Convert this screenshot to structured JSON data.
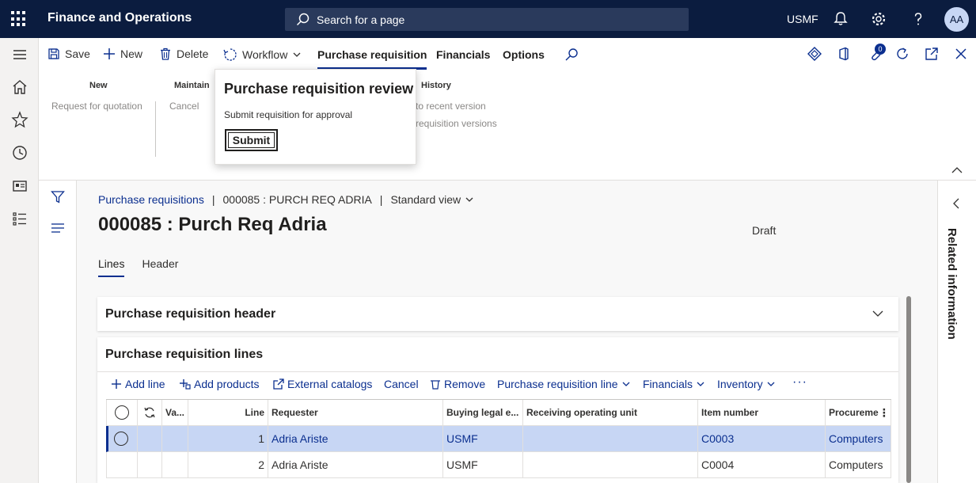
{
  "topbar": {
    "app_title": "Finance and Operations",
    "search_placeholder": "Search for a page",
    "company": "USMF",
    "avatar_initials": "AA",
    "icons": [
      "waffle-icon",
      "search-icon",
      "bell-icon",
      "gear-icon",
      "help-icon"
    ]
  },
  "actions": {
    "save": "Save",
    "new": "New",
    "delete": "Delete",
    "workflow": "Workflow",
    "tabs": [
      "Purchase requisition",
      "Financials",
      "Options"
    ],
    "notification_count": "0"
  },
  "ribbon": {
    "groups": [
      {
        "title": "New",
        "items": [
          "Request for quotation"
        ]
      },
      {
        "title": "Maintain",
        "items": [
          "Cancel"
        ]
      },
      {
        "title": "History",
        "items": [
          "to recent version",
          "requisition versions"
        ]
      }
    ]
  },
  "flyout": {
    "title": "Purchase requisition review",
    "subtitle": "Submit requisition for approval",
    "button": "Submit"
  },
  "page": {
    "breadcrumb_link": "Purchase requisitions",
    "breadcrumb_record": "000085 : PURCH REQ ADRIA",
    "view": "Standard view",
    "title": "000085 : Purch Req Adria",
    "status": "Draft",
    "tabs": [
      "Lines",
      "Header"
    ],
    "related_info": "Related information"
  },
  "header_card": {
    "title": "Purchase requisition header"
  },
  "lines_card": {
    "title": "Purchase requisition lines",
    "toolbar": [
      "Add line",
      "Add products",
      "External catalogs",
      "Cancel",
      "Remove",
      "Purchase requisition line",
      "Financials",
      "Inventory"
    ],
    "columns": [
      "Va...",
      "Line",
      "Requester",
      "Buying legal e...",
      "Receiving operating unit",
      "Item number",
      "Procureme"
    ],
    "rows": [
      {
        "line": "1",
        "requester": "Adria Ariste",
        "legal": "USMF",
        "unit": "",
        "item": "C0003",
        "proc": "Computers",
        "selected": true
      },
      {
        "line": "2",
        "requester": "Adria Ariste",
        "legal": "USMF",
        "unit": "",
        "item": "C0004",
        "proc": "Computers",
        "selected": false
      }
    ]
  },
  "colors": {
    "topbar": "#0b1c3f",
    "accent": "#0b2f8f",
    "selected_row": "#c7d6f4"
  }
}
